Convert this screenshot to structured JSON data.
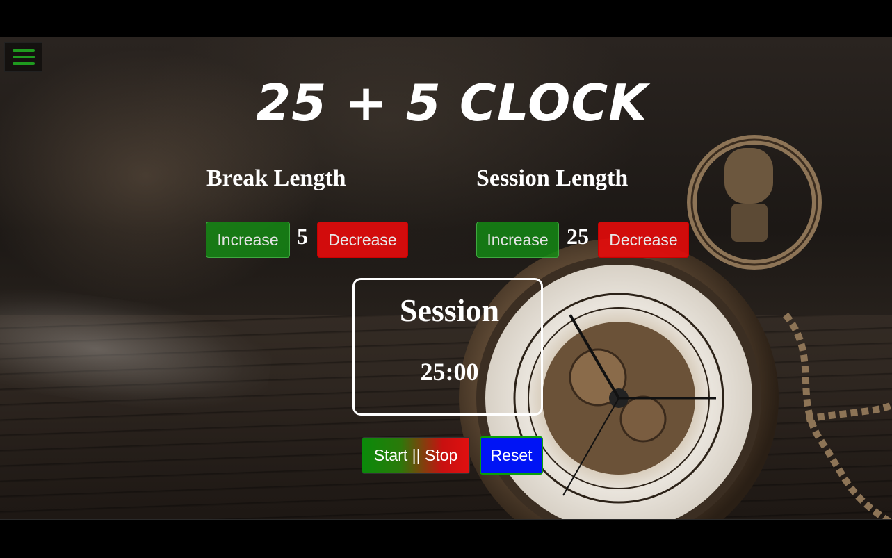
{
  "app": {
    "title": "25 + 5 CLOCK"
  },
  "menu": {
    "icon": "hamburger-menu-icon",
    "icon_color": "#1f9a1f"
  },
  "break": {
    "label": "Break Length",
    "increase_label": "Increase",
    "value": "5",
    "decrease_label": "Decrease"
  },
  "session": {
    "label": "Session Length",
    "increase_label": "Increase",
    "value": "25",
    "decrease_label": "Decrease"
  },
  "timer": {
    "label": "Session",
    "time": "25:00"
  },
  "controls": {
    "start_stop_label": "Start || Stop",
    "reset_label": "Reset"
  },
  "colors": {
    "increase": "#148c14",
    "decrease": "#eb0a0a",
    "reset": "#0014f5"
  }
}
